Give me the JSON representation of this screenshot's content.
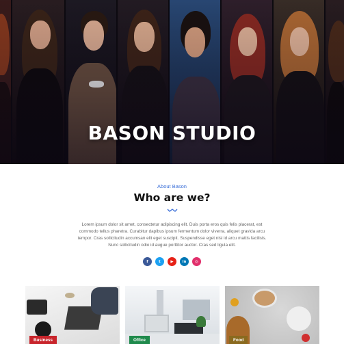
{
  "hero": {
    "title": "BASON STUDIO"
  },
  "about": {
    "eyebrow": "About Bason",
    "title": "Who are we?",
    "description": "Lorem ipsum dolor sit amet, consectetur adipiscing elit. Duis porta eros quis felis placerat, est commodo tellus pharetra. Curabitur dapibus ipsum fermentum dolor viverra, aliquet gravida arcu tempor. Cras sollicitudin accumsan elit eget suscipit. Suspendisse eget nisl id arcu mattis facilisis. Nunc sollicitudin odio id augue porttitor auctor. Cras sed ligula elit.",
    "accent_color": "#3b6fd8"
  },
  "socials": [
    {
      "icon": "facebook-icon",
      "glyph": "f",
      "color": "#3b5998"
    },
    {
      "icon": "twitter-icon",
      "glyph": "t",
      "color": "#1da1f2"
    },
    {
      "icon": "youtube-icon",
      "glyph": "▶",
      "color": "#e62117"
    },
    {
      "icon": "linkedin-icon",
      "glyph": "in",
      "color": "#0077b5"
    },
    {
      "icon": "instagram-icon",
      "glyph": "◎",
      "color": "#e1306c"
    }
  ],
  "cards": [
    {
      "label": "Business",
      "badge_color": "#c8242b"
    },
    {
      "label": "Office",
      "badge_color": "#1f8a4c"
    },
    {
      "label": "Food",
      "badge_color": "#8a6a1f"
    }
  ]
}
